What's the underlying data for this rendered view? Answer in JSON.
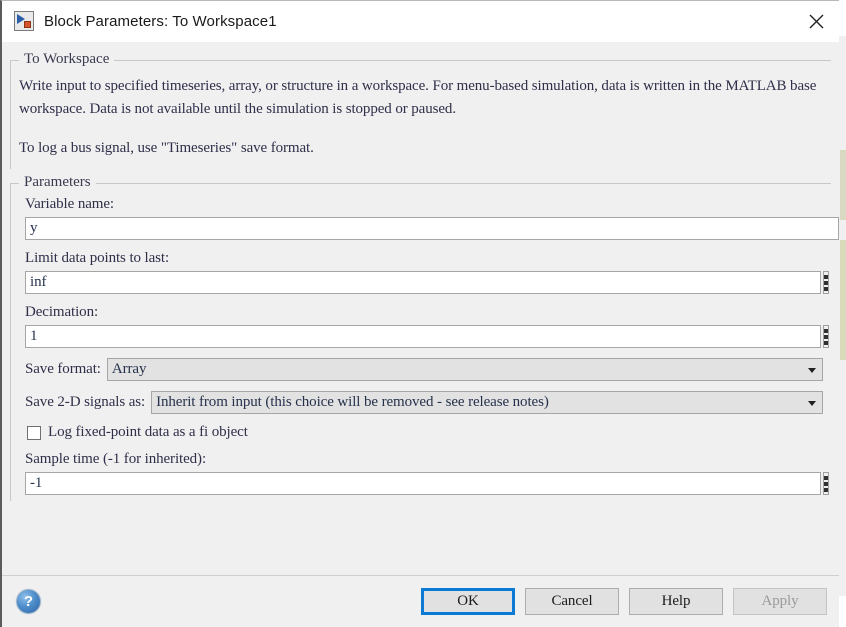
{
  "window": {
    "title": "Block Parameters: To Workspace1",
    "icon": "simulink-block-icon",
    "close_label": "close-icon"
  },
  "description_group": {
    "legend": "To Workspace",
    "paragraphs": [
      "Write input to specified timeseries, array, or structure in a workspace. For menu-based simulation, data is written in the MATLAB base workspace. Data is not available until the simulation is stopped or paused.",
      "To log a bus signal, use \"Timeseries\" save format."
    ]
  },
  "parameters_group": {
    "legend": "Parameters",
    "variable_name": {
      "label": "Variable name:",
      "value": "y"
    },
    "limit_data_points": {
      "label": "Limit data points to last:",
      "value": "inf",
      "spinner": "vertical-ellipsis-icon"
    },
    "decimation": {
      "label": "Decimation:",
      "value": "1",
      "spinner": "vertical-ellipsis-icon"
    },
    "save_format": {
      "label": "Save format:",
      "value": "Array"
    },
    "save_2d_signals_as": {
      "label": "Save 2-D signals as:",
      "value": "Inherit from input (this choice will be removed - see release notes)"
    },
    "log_fixed_point": {
      "label": "Log fixed-point data as a fi object",
      "checked": false
    },
    "sample_time": {
      "label": "Sample time (-1 for inherited):",
      "value": "-1",
      "spinner": "vertical-ellipsis-icon"
    }
  },
  "footer": {
    "help_icon_label": "?",
    "buttons": {
      "ok": "OK",
      "cancel": "Cancel",
      "help": "Help",
      "apply": "Apply"
    }
  },
  "colors": {
    "accent_blue": "#0b7ad4",
    "dialog_bg": "#f0f0f0",
    "text": "#2f2f4a"
  }
}
